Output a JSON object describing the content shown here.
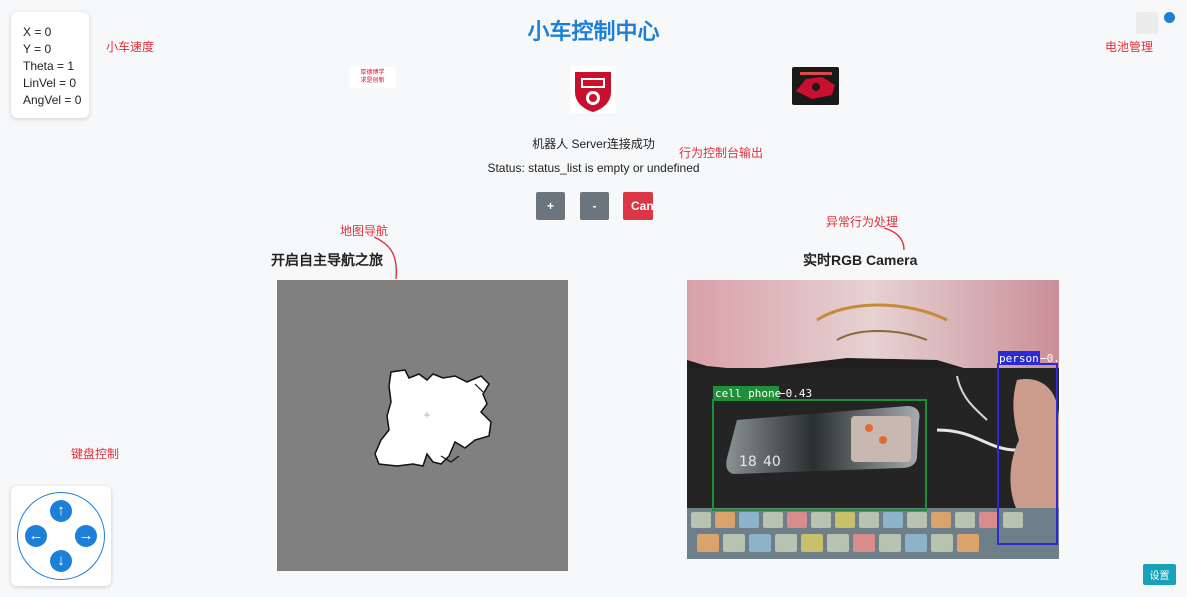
{
  "header": {
    "title": "小车控制中心"
  },
  "odometry": {
    "x": "X = 0",
    "y": "Y = 0",
    "theta": "Theta = 1",
    "linvel": "LinVel = 0",
    "angvel": "AngVel = 0"
  },
  "annotations": {
    "speed": "小车速度",
    "battery": "电池管理",
    "console": "行为控制台输出",
    "map_nav": "地图导航",
    "anomaly": "异常行为处理",
    "keyboard": "键盘控制"
  },
  "logos": {
    "left_text_1": "厚德博学",
    "left_text_2": "求是创新"
  },
  "status": {
    "connection": "机器人 Server连接成功",
    "status_line": "Status: status_list is empty or undefined"
  },
  "controls": {
    "plus_label": "+",
    "minus_label": "-",
    "cancel_label": "Cancel"
  },
  "map_section": {
    "title": "开启自主导航之旅"
  },
  "camera_section": {
    "title": "实时RGB Camera",
    "detections": [
      {
        "label": "cell phone",
        "score": "−0.43",
        "color": "#1f8f3a"
      },
      {
        "label": "person",
        "score": "−0.",
        "color": "#2b2bd6"
      }
    ],
    "phone_time_1": "18",
    "phone_time_2": "40"
  },
  "joystick": {
    "up": "↑",
    "down": "↓",
    "left": "←",
    "right": "→"
  },
  "settings": {
    "label": "设置"
  },
  "colors": {
    "accent": "#1e7fd8",
    "annotation": "#e0313b",
    "cancel": "#dc3545",
    "secondary": "#6c757d",
    "settings": "#17a2b8"
  }
}
